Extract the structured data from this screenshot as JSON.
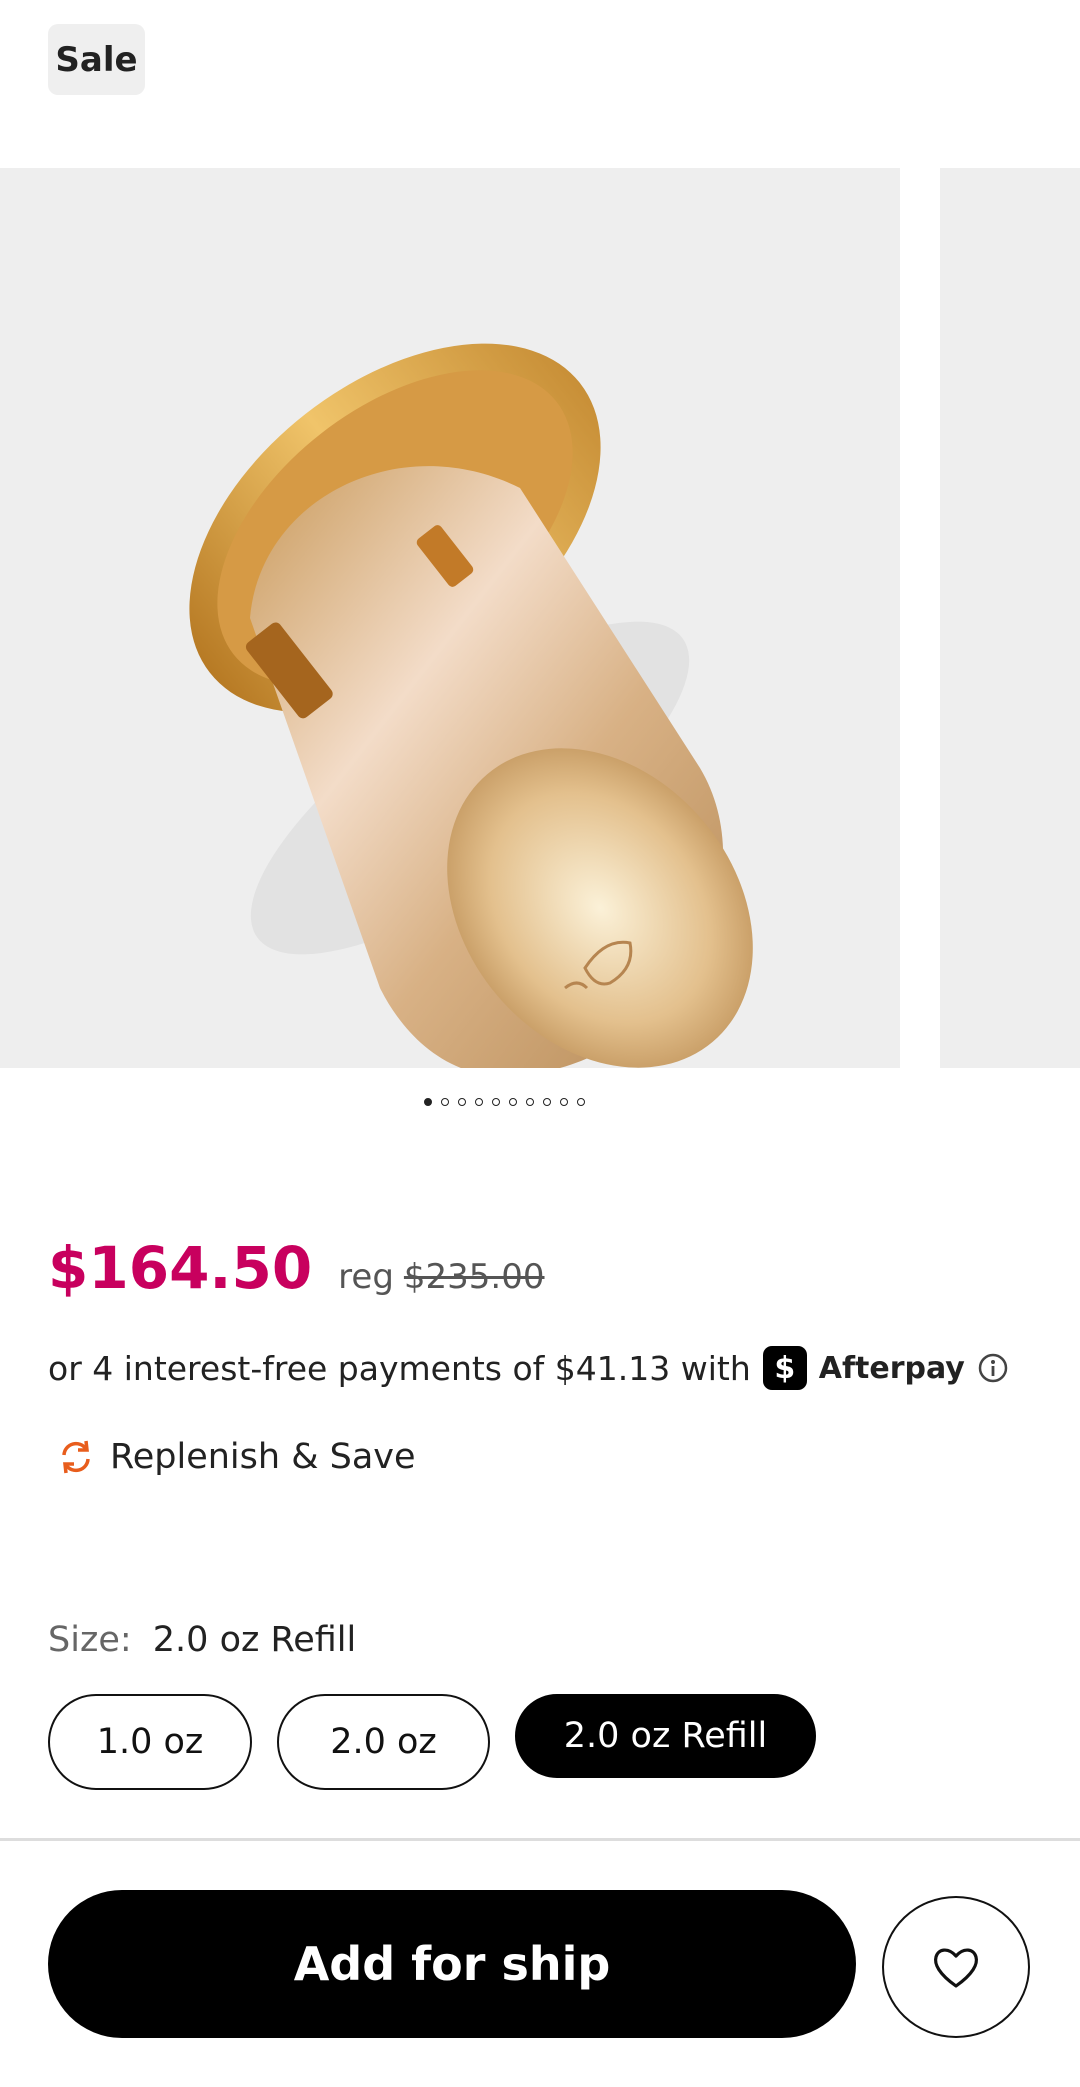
{
  "badge": {
    "label": "Sale"
  },
  "carousel": {
    "slide_count": 10,
    "active_index": 0
  },
  "pricing": {
    "sale_price": "$164.50",
    "reg_label": "reg",
    "reg_price": "$235.00"
  },
  "afterpay": {
    "text": "or 4 interest-free payments of $41.13 with",
    "logo_glyph": "$",
    "brand": "Afterpay"
  },
  "replenish": {
    "label": "Replenish & Save",
    "icon_color": "#e85d1c"
  },
  "size": {
    "label": "Size:",
    "selected": "2.0 oz Refill",
    "options": [
      "1.0 oz",
      "2.0 oz",
      "2.0 oz Refill"
    ]
  },
  "actions": {
    "add_label": "Add for ship"
  },
  "colors": {
    "accent_price": "#c8005e",
    "primary_button": "#000000"
  }
}
